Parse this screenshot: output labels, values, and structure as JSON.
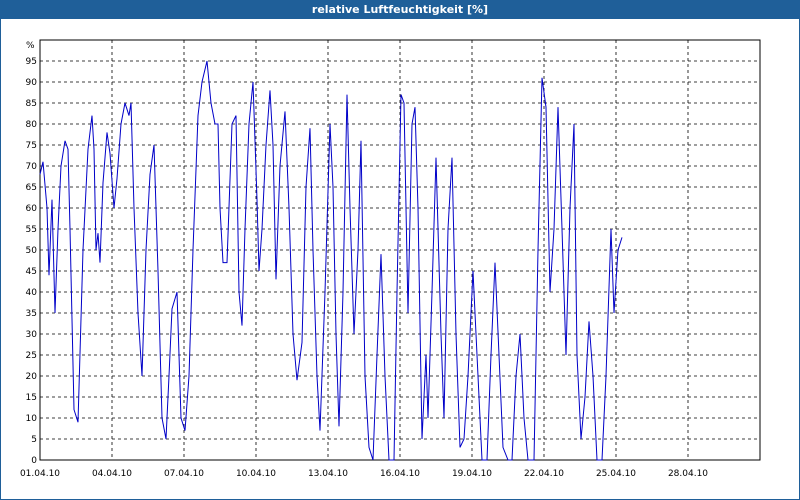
{
  "window": {
    "title": "relative Luftfeuchtigkeit [%]"
  },
  "chart_data": {
    "type": "line",
    "title": "relative Luftfeuchtigkeit [%]",
    "ylabel": "%",
    "xlabel": "",
    "ylim": [
      0,
      100
    ],
    "xlim": [
      "01.04.10 00:00",
      "01.05.10 00:00"
    ],
    "grid": true,
    "y_ticks": [
      0,
      5,
      10,
      15,
      20,
      25,
      30,
      35,
      40,
      45,
      50,
      55,
      60,
      65,
      70,
      75,
      80,
      85,
      90,
      95
    ],
    "x_ticks": [
      "01.04.10",
      "04.04.10",
      "07.04.10",
      "10.04.10",
      "13.04.10",
      "16.04.10",
      "19.04.10",
      "22.04.10",
      "25.04.10",
      "28.04.10"
    ],
    "line_color": "#0000c8",
    "series": [
      {
        "name": "",
        "points": [
          [
            "01.04.10 00:00",
            68
          ],
          [
            "01.04.10 03:00",
            71
          ],
          [
            "01.04.10 07:00",
            60
          ],
          [
            "01.04.10 09:00",
            44
          ],
          [
            "01.04.10 12:00",
            62
          ],
          [
            "01.04.10 15:00",
            35
          ],
          [
            "01.04.10 18:00",
            55
          ],
          [
            "01.04.10 21:00",
            70
          ],
          [
            "02.04.10 01:00",
            76
          ],
          [
            "02.04.10 04:00",
            74
          ],
          [
            "02.04.10 06:00",
            55
          ],
          [
            "02.04.10 10:00",
            12
          ],
          [
            "02.04.10 14:00",
            9
          ],
          [
            "02.04.10 19:00",
            50
          ],
          [
            "03.04.10 00:00",
            74
          ],
          [
            "03.04.10 04:00",
            82
          ],
          [
            "03.04.10 06:00",
            74
          ],
          [
            "03.04.10 08:00",
            50
          ],
          [
            "03.04.10 10:00",
            54
          ],
          [
            "03.04.10 12:00",
            47
          ],
          [
            "03.04.10 15:00",
            66
          ],
          [
            "03.04.10 19:00",
            78
          ],
          [
            "03.04.10 22:00",
            73
          ],
          [
            "04.04.10 02:00",
            60
          ],
          [
            "04.04.10 05:00",
            67
          ],
          [
            "04.04.10 09:00",
            80
          ],
          [
            "04.04.10 13:00",
            85
          ],
          [
            "04.04.10 17:00",
            82
          ],
          [
            "04.04.10 19:00",
            85
          ],
          [
            "04.04.10 22:00",
            60
          ],
          [
            "05.04.10 02:00",
            35
          ],
          [
            "05.04.10 06:00",
            20
          ],
          [
            "05.04.10 10:00",
            50
          ],
          [
            "05.04.10 14:00",
            68
          ],
          [
            "05.04.10 18:00",
            75
          ],
          [
            "05.04.10 22:00",
            45
          ],
          [
            "06.04.10 02:00",
            10
          ],
          [
            "06.04.10 06:00",
            5
          ],
          [
            "06.04.10 09:00",
            20
          ],
          [
            "06.04.10 12:00",
            36
          ],
          [
            "06.04.10 17:00",
            40
          ],
          [
            "06.04.10 21:00",
            10
          ],
          [
            "07.04.10 01:00",
            7
          ],
          [
            "07.04.10 05:00",
            20
          ],
          [
            "07.04.10 09:00",
            50
          ],
          [
            "07.04.10 14:00",
            82
          ],
          [
            "07.04.10 18:00",
            90
          ],
          [
            "07.04.10 23:00",
            95
          ],
          [
            "08.04.10 03:00",
            85
          ],
          [
            "08.04.10 07:00",
            80
          ],
          [
            "08.04.10 10:00",
            80
          ],
          [
            "08.04.10 12:00",
            60
          ],
          [
            "08.04.10 15:00",
            47
          ],
          [
            "08.04.10 19:00",
            47
          ],
          [
            "09.04.10 00:00",
            80
          ],
          [
            "09.04.10 04:00",
            82
          ],
          [
            "09.04.10 07:00",
            40
          ],
          [
            "09.04.10 10:00",
            32
          ],
          [
            "09.04.10 13:00",
            55
          ],
          [
            "09.04.10 17:00",
            80
          ],
          [
            "09.04.10 21:00",
            90
          ],
          [
            "10.04.10 01:00",
            62
          ],
          [
            "10.04.10 03:00",
            45
          ],
          [
            "10.04.10 06:00",
            55
          ],
          [
            "10.04.10 10:00",
            75
          ],
          [
            "10.04.10 14:00",
            88
          ],
          [
            "10.04.10 17:00",
            75
          ],
          [
            "10.04.10 20:00",
            43
          ],
          [
            "11.04.10 00:00",
            70
          ],
          [
            "11.04.10 05:00",
            83
          ],
          [
            "11.04.10 09:00",
            60
          ],
          [
            "11.04.10 13:00",
            30
          ],
          [
            "11.04.10 17:00",
            19
          ],
          [
            "11.04.10 22:00",
            28
          ],
          [
            "12.04.10 02:00",
            65
          ],
          [
            "12.04.10 06:00",
            79
          ],
          [
            "12.04.10 09:00",
            50
          ],
          [
            "12.04.10 13:00",
            20
          ],
          [
            "12.04.10 16:00",
            7
          ],
          [
            "12.04.10 21:00",
            40
          ],
          [
            "13.04.10 02:00",
            80
          ],
          [
            "13.04.10 05:00",
            65
          ],
          [
            "13.04.10 08:00",
            30
          ],
          [
            "13.04.10 11:00",
            8
          ],
          [
            "13.04.10 15:00",
            40
          ],
          [
            "13.04.10 19:00",
            87
          ],
          [
            "13.04.10 22:00",
            60
          ],
          [
            "14.04.10 02:00",
            30
          ],
          [
            "14.04.10 06:00",
            50
          ],
          [
            "14.04.10 09:00",
            76
          ],
          [
            "14.04.10 13:00",
            20
          ],
          [
            "14.04.10 17:00",
            3
          ],
          [
            "14.04.10 21:00",
            0
          ],
          [
            "15.04.10 01:00",
            25
          ],
          [
            "15.04.10 05:00",
            49
          ],
          [
            "15.04.10 09:00",
            20
          ],
          [
            "15.04.10 13:00",
            0
          ],
          [
            "15.04.10 18:00",
            0
          ],
          [
            "15.04.10 21:00",
            40
          ],
          [
            "16.04.10 01:00",
            87
          ],
          [
            "16.04.10 04:00",
            85
          ],
          [
            "16.04.10 08:00",
            35
          ],
          [
            "16.04.10 12:00",
            80
          ],
          [
            "16.04.10 15:00",
            84
          ],
          [
            "16.04.10 18:00",
            60
          ],
          [
            "16.04.10 22:00",
            5
          ],
          [
            "17.04.10 02:00",
            25
          ],
          [
            "17.04.10 04:00",
            10
          ],
          [
            "17.04.10 08:00",
            40
          ],
          [
            "17.04.10 12:00",
            72
          ],
          [
            "17.04.10 17:00",
            30
          ],
          [
            "17.04.10 20:00",
            10
          ],
          [
            "18.04.10 00:00",
            55
          ],
          [
            "18.04.10 04:00",
            72
          ],
          [
            "18.04.10 08:00",
            30
          ],
          [
            "18.04.10 12:00",
            3
          ],
          [
            "18.04.10 16:00",
            5
          ],
          [
            "18.04.10 20:00",
            20
          ],
          [
            "19.04.10 01:00",
            45
          ],
          [
            "19.04.10 06:00",
            20
          ],
          [
            "19.04.10 10:00",
            0
          ],
          [
            "19.04.10 15:00",
            0
          ],
          [
            "19.04.10 19:00",
            25
          ],
          [
            "19.04.10 23:00",
            47
          ],
          [
            "20.04.10 03:00",
            25
          ],
          [
            "20.04.10 07:00",
            3
          ],
          [
            "20.04.10 12:00",
            0
          ],
          [
            "20.04.10 16:00",
            0
          ],
          [
            "20.04.10 20:00",
            20
          ],
          [
            "21.04.10 00:00",
            30
          ],
          [
            "21.04.10 04:00",
            10
          ],
          [
            "21.04.10 08:00",
            0
          ],
          [
            "21.04.10 14:00",
            0
          ],
          [
            "21.04.10 18:00",
            50
          ],
          [
            "21.04.10 22:00",
            91
          ],
          [
            "22.04.10 02:00",
            84
          ],
          [
            "22.04.10 06:00",
            40
          ],
          [
            "22.04.10 10:00",
            55
          ],
          [
            "22.04.10 14:00",
            84
          ],
          [
            "22.04.10 18:00",
            55
          ],
          [
            "22.04.10 22:00",
            25
          ],
          [
            "23.04.10 02:00",
            60
          ],
          [
            "23.04.10 06:00",
            80
          ],
          [
            "23.04.10 09:00",
            25
          ],
          [
            "23.04.10 13:00",
            5
          ],
          [
            "23.04.10 17:00",
            15
          ],
          [
            "23.04.10 21:00",
            33
          ],
          [
            "24.04.10 01:00",
            20
          ],
          [
            "24.04.10 05:00",
            0
          ],
          [
            "24.04.10 10:00",
            0
          ],
          [
            "24.04.10 14:00",
            20
          ],
          [
            "24.04.10 19:00",
            55
          ],
          [
            "24.04.10 22:00",
            35
          ],
          [
            "25.04.10 02:00",
            50
          ],
          [
            "25.04.10 06:00",
            53
          ]
        ]
      }
    ]
  }
}
